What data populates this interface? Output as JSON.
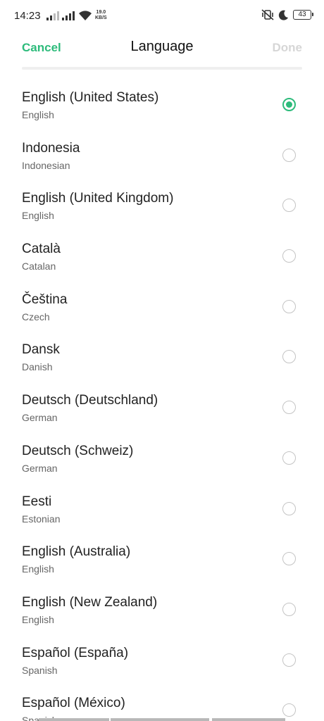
{
  "status_bar": {
    "time": "14:23",
    "net_speed_value": "19.0",
    "net_speed_unit": "KB/S",
    "battery": "43",
    "icons": [
      "signal-icon",
      "signal-icon",
      "wifi-icon",
      "vibrate-icon",
      "moon-icon",
      "battery-icon"
    ]
  },
  "nav": {
    "cancel_label": "Cancel",
    "title": "Language",
    "done_label": "Done"
  },
  "colors": {
    "accent": "#2dbb7b",
    "disabled": "#d6d6d6"
  },
  "languages": [
    {
      "name": "English (United States)",
      "sub": "English",
      "selected": true
    },
    {
      "name": "Indonesia",
      "sub": "Indonesian",
      "selected": false
    },
    {
      "name": "English (United Kingdom)",
      "sub": "English",
      "selected": false
    },
    {
      "name": "Català",
      "sub": "Catalan",
      "selected": false
    },
    {
      "name": "Čeština",
      "sub": "Czech",
      "selected": false
    },
    {
      "name": "Dansk",
      "sub": "Danish",
      "selected": false
    },
    {
      "name": "Deutsch (Deutschland)",
      "sub": "German",
      "selected": false
    },
    {
      "name": "Deutsch (Schweiz)",
      "sub": "German",
      "selected": false
    },
    {
      "name": "Eesti",
      "sub": "Estonian",
      "selected": false
    },
    {
      "name": "English (Australia)",
      "sub": "English",
      "selected": false
    },
    {
      "name": "English (New Zealand)",
      "sub": "English",
      "selected": false
    },
    {
      "name": "Español (España)",
      "sub": "Spanish",
      "selected": false
    },
    {
      "name": "Español (México)",
      "sub": "Spanish",
      "selected": false
    }
  ]
}
